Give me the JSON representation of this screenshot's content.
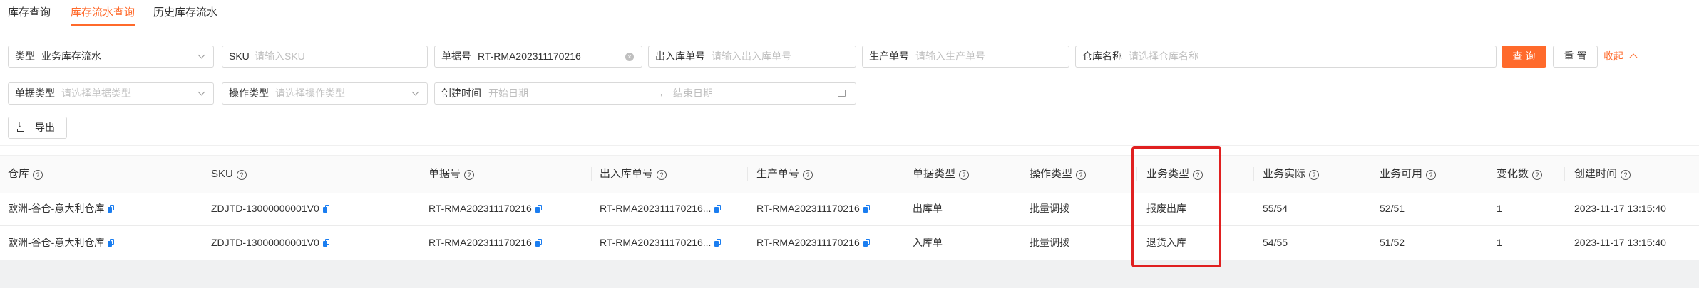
{
  "tabs": [
    {
      "label": "库存查询"
    },
    {
      "label": "库存流水查询"
    },
    {
      "label": "历史库存流水"
    }
  ],
  "filters": {
    "type": {
      "label": "类型",
      "value": "业务库存流水"
    },
    "sku": {
      "label": "SKU",
      "placeholder": "请输入SKU"
    },
    "doc_no": {
      "label": "单据号",
      "value": "RT-RMA202311170216"
    },
    "io_no": {
      "label": "出入库单号",
      "placeholder": "请输入出入库单号"
    },
    "prod_no": {
      "label": "生产单号",
      "placeholder": "请输入生产单号"
    },
    "warehouse": {
      "label": "仓库名称",
      "placeholder": "请选择仓库名称"
    },
    "doc_type": {
      "label": "单据类型",
      "placeholder": "请选择单据类型"
    },
    "op_type": {
      "label": "操作类型",
      "placeholder": "请选择操作类型"
    },
    "created": {
      "label": "创建时间",
      "start_placeholder": "开始日期",
      "end_placeholder": "结束日期"
    }
  },
  "actions": {
    "search": "查 询",
    "reset": "重 置",
    "collapse": "收起",
    "export": "导出"
  },
  "table": {
    "columns": [
      "仓库",
      "SKU",
      "单据号",
      "出入库单号",
      "生产单号",
      "单据类型",
      "操作类型",
      "业务类型",
      "业务实际",
      "业务可用",
      "变化数",
      "创建时间"
    ],
    "rows": [
      {
        "warehouse": "欧洲-谷仓-意大利仓库",
        "sku": "ZDJTD-13000000001V0",
        "doc_no": "RT-RMA202311170216",
        "io_no": "RT-RMA202311170216...",
        "prod_no": "RT-RMA202311170216",
        "doc_type": "出库单",
        "op_type": "批量调拨",
        "biz_type": "报废出库",
        "actual": "55/54",
        "available": "52/51",
        "change": "1",
        "created": "2023-11-17 13:15:40"
      },
      {
        "warehouse": "欧洲-谷仓-意大利仓库",
        "sku": "ZDJTD-13000000001V0",
        "doc_no": "RT-RMA202311170216",
        "io_no": "RT-RMA202311170216...",
        "prod_no": "RT-RMA202311170216",
        "doc_type": "入库单",
        "op_type": "批量调拨",
        "biz_type": "退货入库",
        "actual": "54/55",
        "available": "51/52",
        "change": "1",
        "created": "2023-11-17 13:15:40"
      }
    ]
  },
  "colors": {
    "accent": "#ff6a2b",
    "copy_icon": "#1a7df0",
    "highlight": "#e02020"
  }
}
